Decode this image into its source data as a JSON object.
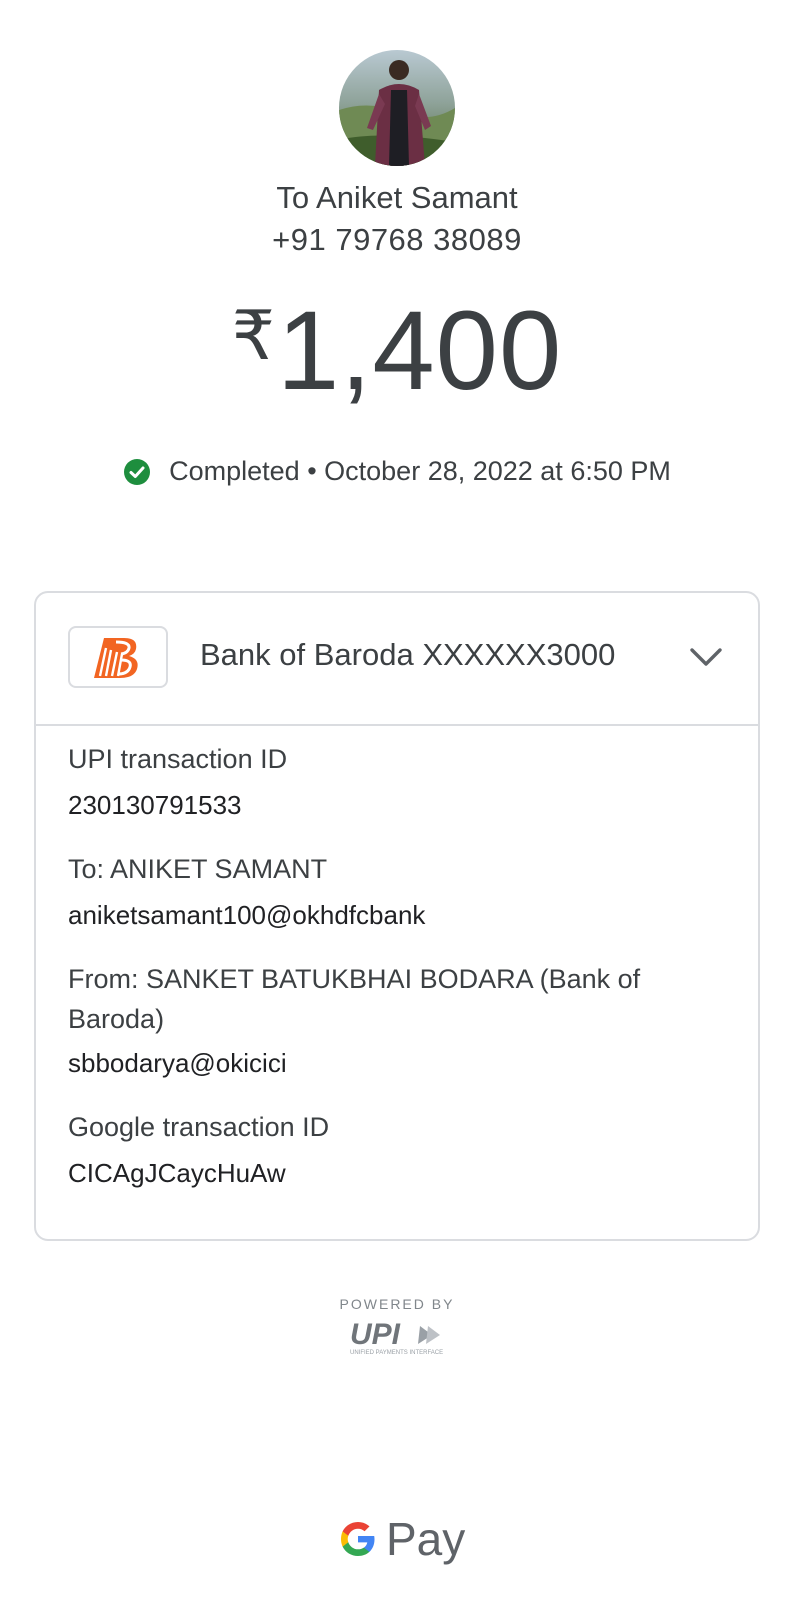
{
  "payee": {
    "name": "To Aniket Samant",
    "phone": "+91 79768 38089"
  },
  "amount": {
    "currency_symbol": "₹",
    "value": "1,400"
  },
  "status": {
    "text": "Completed • October 28, 2022 at 6:50 PM",
    "color": "#1e8e3e"
  },
  "account": {
    "bank_name": "Bank of Baroda XXXXXX3000",
    "logo_color": "#f26522"
  },
  "details": [
    {
      "label": "UPI transaction ID",
      "value": "230130791533"
    },
    {
      "label": "To: ANIKET SAMANT",
      "value": "aniketsamant100@okhdfcbank"
    },
    {
      "label": "From: SANKET BATUKBHAI BODARA (Bank of Baroda)",
      "value": "sbbodarya@okicici"
    },
    {
      "label": "Google transaction ID",
      "value": "CICAgJCaycHuAw"
    }
  ],
  "footer": {
    "powered_by": "POWERED BY",
    "upi_logo_text": "UPI",
    "upi_tagline": "UNIFIED PAYMENTS INTERFACE",
    "gpay_text": "Pay"
  },
  "icons": {
    "avatar": "user-photo",
    "status": "check-circle-icon",
    "chevron": "chevron-down-icon",
    "bank_logo": "bank-of-baroda-logo"
  }
}
